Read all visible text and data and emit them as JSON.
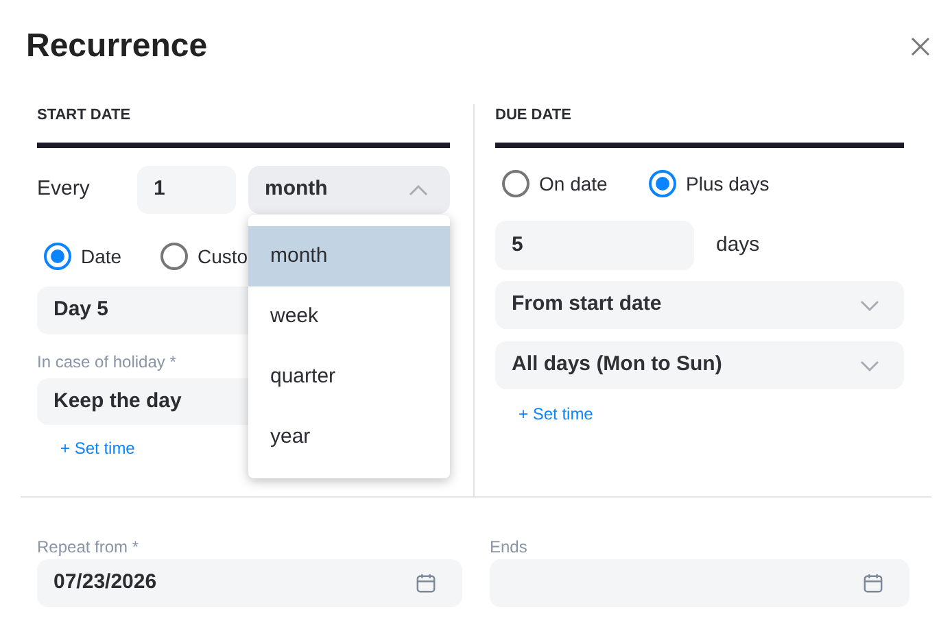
{
  "title": "Recurrence",
  "start_date": {
    "heading": "START DATE",
    "every": {
      "label": "Every",
      "value": "1",
      "unit": {
        "value": "month",
        "expanded": true,
        "options": [
          {
            "label": "month",
            "selected": true
          },
          {
            "label": "week",
            "selected": false
          },
          {
            "label": "quarter",
            "selected": false
          },
          {
            "label": "year",
            "selected": false
          }
        ]
      }
    },
    "mode_options": [
      {
        "label": "Date",
        "selected": true
      },
      {
        "label": "Custo",
        "selected": false
      }
    ],
    "day_field": {
      "value": "Day 5"
    },
    "holiday": {
      "label": "In case of holiday *",
      "value": "Keep the day"
    },
    "set_time": "+ Set time"
  },
  "due_date": {
    "heading": "DUE DATE",
    "mode_options": [
      {
        "label": "On date",
        "selected": false
      },
      {
        "label": "Plus days",
        "selected": true
      }
    ],
    "days": {
      "value": "5",
      "unit": "days"
    },
    "from_select": {
      "value": "From start date",
      "expanded": false
    },
    "days_select": {
      "value": "All days (Mon to Sun)",
      "expanded": false
    },
    "set_time": "+ Set time"
  },
  "repeat_from": {
    "label": "Repeat from *",
    "value": "07/23/2026"
  },
  "ends": {
    "label": "Ends"
  }
}
